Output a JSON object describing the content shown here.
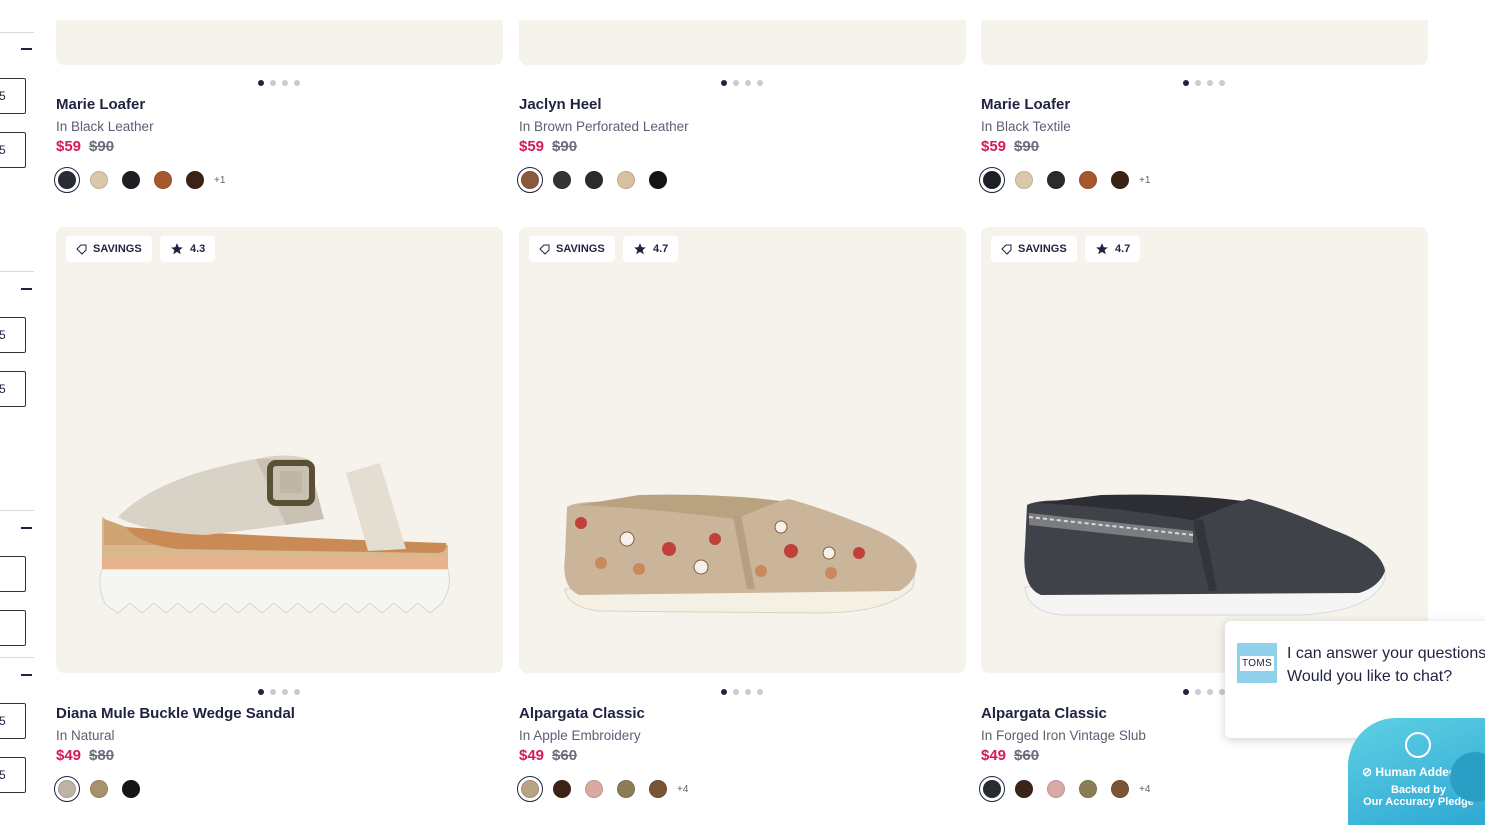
{
  "filters": {
    "box_text": [
      "5",
      "5",
      "5",
      "5",
      "",
      "",
      "5",
      "5"
    ]
  },
  "badges": {
    "savings_label": "SAVINGS"
  },
  "products": [
    {
      "name": "Marie Loafer",
      "color": "In Black Leather",
      "sale_price": "$59",
      "orig_price": "$90",
      "swatches": [
        "#2a2c33",
        "#d9c8aa",
        "#1d1f24",
        "#a8582f",
        "#3b2417"
      ],
      "more": "+1"
    },
    {
      "name": "Jaclyn Heel",
      "color": "In Brown Perforated Leather",
      "sale_price": "$59",
      "orig_price": "$90",
      "swatches": [
        "#8a5a3c",
        "#333333",
        "#2b2b2b",
        "#d8c0a0",
        "#151515"
      ],
      "more": ""
    },
    {
      "name": "Marie Loafer",
      "color": "In Black Textile",
      "sale_price": "$59",
      "orig_price": "$90",
      "swatches": [
        "#1e2027",
        "#d9c8aa",
        "#2a2b2e",
        "#a8582f",
        "#3b2417"
      ],
      "more": "+1"
    },
    {
      "name": "Diana Mule Buckle Wedge Sandal",
      "color": "In Natural",
      "sale_price": "$49",
      "orig_price": "$80",
      "rating": "4.3",
      "swatches": [
        "#bdb4a5",
        "#a8926b",
        "#151515"
      ],
      "more": ""
    },
    {
      "name": "Alpargata Classic",
      "color": "In Apple Embroidery",
      "sale_price": "$49",
      "orig_price": "$60",
      "rating": "4.7",
      "swatches": [
        "#b8a385",
        "#3b2417",
        "#d9aaa4",
        "#8b7d55",
        "#7a5535"
      ],
      "more": "+4"
    },
    {
      "name": "Alpargata Classic",
      "color": "In Forged Iron Vintage Slub",
      "sale_price": "$49",
      "orig_price": "$60",
      "rating": "4.7",
      "swatches": [
        "#2a2c33",
        "#3b2417",
        "#d9aaa4",
        "#8b7d55",
        "#7a5535"
      ],
      "more": "+4"
    }
  ],
  "chat": {
    "logo_text": "TOMS",
    "message": "I can answer your questions. Would you like to chat?",
    "close": "×"
  },
  "pledge": {
    "title": "Human Added",
    "subtitle_1": "Backed by",
    "subtitle_2": "Our Accuracy Pledge"
  }
}
